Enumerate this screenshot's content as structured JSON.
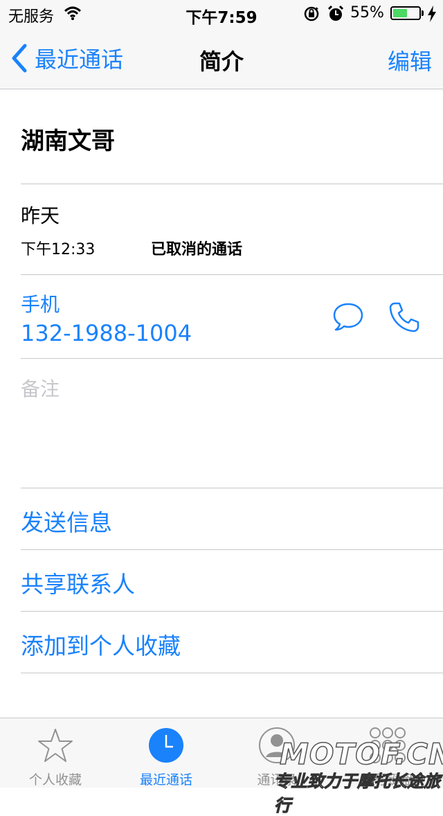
{
  "status_bar": {
    "carrier": "无服务",
    "time": "下午7:59",
    "battery_percent": "55%",
    "battery_level": 0.55,
    "icons": [
      "wifi-icon",
      "rotation-lock-icon",
      "alarm-icon",
      "battery-icon",
      "charging-icon"
    ]
  },
  "nav": {
    "back_label": "最近通话",
    "title": "简介",
    "edit_label": "编辑"
  },
  "contact": {
    "name": "湖南文哥",
    "call_day": "昨天",
    "call_time": "下午12:33",
    "call_status": "已取消的通话",
    "phone_label": "手机",
    "phone_number": "132-1988-1004",
    "notes_label": "备注"
  },
  "actions": [
    {
      "label": "发送信息"
    },
    {
      "label": "共享联系人"
    },
    {
      "label": "添加到个人收藏"
    }
  ],
  "tabs": [
    {
      "label": "个人收藏",
      "icon": "star-icon",
      "active": false
    },
    {
      "label": "最近通话",
      "icon": "clock-icon",
      "active": true
    },
    {
      "label": "通讯录",
      "icon": "person-icon",
      "active": false
    },
    {
      "label": "拨号键盘",
      "icon": "keypad-icon",
      "active": false
    }
  ],
  "watermark": {
    "logo": "MOTOF.CN",
    "tagline": "专业致力于摩托长途旅行"
  },
  "colors": {
    "accent": "#1a82fb",
    "separator": "#c8c7cc",
    "placeholder": "#c7c7cc",
    "tab_inactive": "#929292",
    "battery_fill": "#4cd964",
    "bar_background": "#f7f7f7"
  }
}
